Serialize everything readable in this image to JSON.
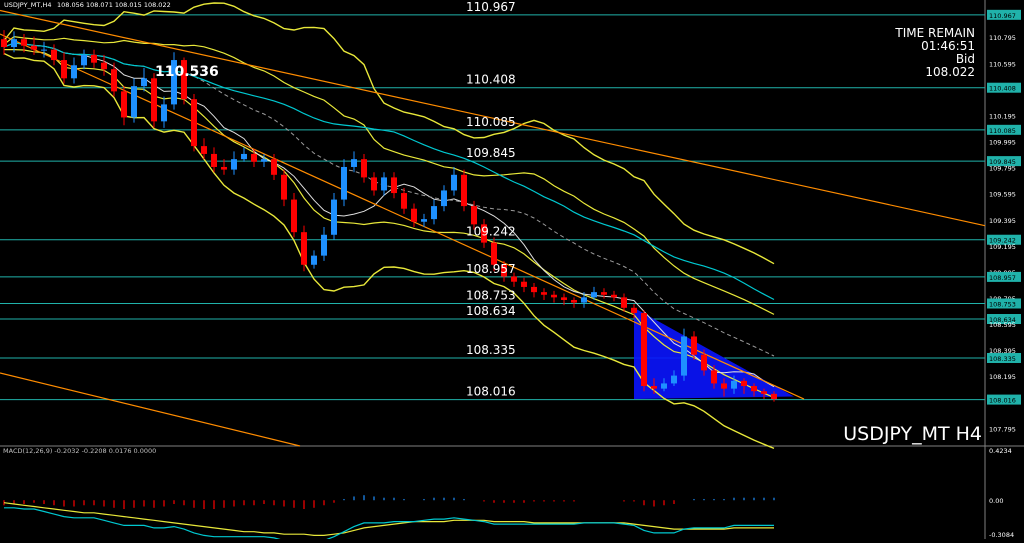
{
  "header": {
    "symbol_line": "USDJPY_MT,H4",
    "ohlc": "108.056 108.071 108.015 108.022"
  },
  "info_panel": {
    "time_remain_label": "TIME REMAIN",
    "time_remain_value": "01:46:51",
    "bid_label": "Bid",
    "bid_value": "108.022"
  },
  "watermark": "USDJPY_MT  H4",
  "macd_header": "MACD(12,26,9) -0.2032 -0.2208 0.0176 0.0000",
  "colors": {
    "background": "#000000",
    "bull": "#1e90ff",
    "bear": "#ff0000",
    "band": "#e8e83a",
    "level_line": "#20b2aa",
    "trend_line": "#ff8c00",
    "ma_cyan": "#00c8d0",
    "triangle_fill": "#0a14ff"
  },
  "chart_data": [
    {
      "type": "candlestick",
      "panel": "price",
      "symbol": "USDJPY_MT",
      "timeframe": "H4",
      "ylim": [
        107.66,
        111.05
      ],
      "yticks": [
        "110.967",
        "110.795",
        "110.595",
        "110.408",
        "110.195",
        "110.085",
        "109.995",
        "109.845",
        "109.795",
        "109.595",
        "109.395",
        "109.242",
        "109.195",
        "108.995",
        "108.957",
        "108.795",
        "108.753",
        "108.634",
        "108.595",
        "108.395",
        "108.335",
        "108.195",
        "108.016",
        "107.795"
      ],
      "highlighted_ticks": [
        "110.967",
        "110.408",
        "110.085",
        "109.845",
        "109.242",
        "108.957",
        "108.753",
        "108.634",
        "108.335",
        "108.016"
      ],
      "level_labels": [
        "110.967",
        "110.408",
        "110.085",
        "109.845",
        "109.242",
        "108.957",
        "108.753",
        "108.634",
        "108.335",
        "108.016"
      ],
      "annotations": [
        {
          "text": "110.536",
          "value": 110.536
        }
      ],
      "close": [
        110.72,
        110.78,
        110.73,
        110.7,
        110.7,
        110.62,
        110.48,
        110.58,
        110.66,
        110.6,
        110.55,
        110.38,
        110.18,
        110.42,
        110.48,
        110.15,
        110.28,
        110.62,
        110.32,
        109.96,
        109.9,
        109.8,
        109.78,
        109.86,
        109.9,
        109.84,
        109.86,
        109.74,
        109.55,
        109.3,
        109.05,
        109.12,
        109.28,
        109.55,
        109.8,
        109.86,
        109.72,
        109.62,
        109.72,
        109.6,
        109.48,
        109.38,
        109.4,
        109.5,
        109.62,
        109.74,
        109.5,
        109.36,
        109.22,
        109.05,
        108.96,
        108.92,
        108.88,
        108.84,
        108.82,
        108.8,
        108.78,
        108.76,
        108.8,
        108.84,
        108.82,
        108.8,
        108.72,
        108.68,
        108.12,
        108.1,
        108.14,
        108.2,
        108.5,
        108.36,
        108.24,
        108.14,
        108.1,
        108.16,
        108.12,
        108.08,
        108.06,
        108.02
      ],
      "open": [
        110.78,
        110.72,
        110.78,
        110.73,
        110.7,
        110.7,
        110.62,
        110.48,
        110.58,
        110.66,
        110.6,
        110.55,
        110.38,
        110.18,
        110.42,
        110.48,
        110.15,
        110.28,
        110.62,
        110.32,
        109.96,
        109.9,
        109.8,
        109.78,
        109.86,
        109.9,
        109.84,
        109.86,
        109.74,
        109.55,
        109.3,
        109.05,
        109.12,
        109.28,
        109.55,
        109.8,
        109.86,
        109.72,
        109.62,
        109.72,
        109.6,
        109.48,
        109.38,
        109.4,
        109.5,
        109.62,
        109.74,
        109.5,
        109.36,
        109.22,
        109.05,
        108.96,
        108.92,
        108.88,
        108.84,
        108.82,
        108.8,
        108.78,
        108.76,
        108.8,
        108.84,
        108.82,
        108.8,
        108.72,
        108.68,
        108.12,
        108.1,
        108.14,
        108.2,
        108.5,
        108.36,
        108.24,
        108.14,
        108.1,
        108.16,
        108.12,
        108.08,
        108.06
      ],
      "high": [
        110.85,
        110.84,
        110.82,
        110.8,
        110.76,
        110.74,
        110.68,
        110.64,
        110.7,
        110.7,
        110.66,
        110.6,
        110.42,
        110.48,
        110.56,
        110.52,
        110.34,
        110.68,
        110.64,
        110.36,
        110.02,
        109.95,
        109.86,
        109.92,
        109.95,
        109.94,
        109.9,
        109.9,
        109.78,
        109.6,
        109.35,
        109.16,
        109.34,
        109.6,
        109.86,
        109.92,
        109.9,
        109.76,
        109.76,
        109.76,
        109.64,
        109.52,
        109.44,
        109.55,
        109.66,
        109.8,
        109.78,
        109.54,
        109.4,
        109.26,
        109.08,
        108.99,
        108.95,
        108.91,
        108.87,
        108.85,
        108.83,
        108.8,
        108.84,
        108.88,
        108.87,
        108.85,
        108.83,
        108.75,
        108.7,
        108.18,
        108.18,
        108.24,
        108.56,
        108.54,
        108.4,
        108.28,
        108.18,
        108.2,
        108.18,
        108.14,
        108.1,
        108.08
      ],
      "low": [
        110.66,
        110.68,
        110.68,
        110.66,
        110.64,
        110.58,
        110.44,
        110.44,
        110.55,
        110.56,
        110.5,
        110.34,
        110.12,
        110.14,
        110.38,
        110.1,
        110.1,
        110.24,
        110.28,
        109.92,
        109.86,
        109.76,
        109.74,
        109.74,
        109.84,
        109.8,
        109.8,
        109.7,
        109.5,
        109.26,
        109.0,
        109.02,
        109.08,
        109.24,
        109.5,
        109.76,
        109.68,
        109.58,
        109.58,
        109.56,
        109.44,
        109.34,
        109.34,
        109.36,
        109.46,
        109.58,
        109.46,
        109.32,
        109.18,
        109.0,
        108.92,
        108.88,
        108.84,
        108.8,
        108.78,
        108.76,
        108.74,
        108.72,
        108.72,
        108.78,
        108.79,
        108.77,
        108.69,
        108.64,
        108.08,
        108.06,
        108.08,
        108.12,
        108.16,
        108.32,
        108.2,
        108.1,
        108.04,
        108.06,
        108.06,
        108.04,
        108.02,
        108.0
      ]
    },
    {
      "type": "bar",
      "panel": "macd",
      "ylim": [
        -0.3084,
        0.4234
      ],
      "yticks": [
        "0.4234",
        "0.00",
        "-0.3084"
      ],
      "histogram": [
        -0.04,
        -0.03,
        -0.03,
        -0.02,
        -0.03,
        -0.04,
        -0.05,
        -0.05,
        -0.04,
        -0.04,
        -0.05,
        -0.06,
        -0.07,
        -0.06,
        -0.05,
        -0.06,
        -0.05,
        -0.03,
        -0.04,
        -0.06,
        -0.07,
        -0.07,
        -0.06,
        -0.05,
        -0.04,
        -0.04,
        -0.03,
        -0.04,
        -0.05,
        -0.06,
        -0.07,
        -0.06,
        -0.04,
        -0.02,
        0.01,
        0.03,
        0.04,
        0.03,
        0.02,
        0.02,
        0.01,
        0.0,
        0.01,
        0.02,
        0.02,
        0.02,
        0.01,
        0.0,
        -0.01,
        -0.02,
        -0.02,
        -0.02,
        -0.02,
        -0.01,
        -0.01,
        -0.01,
        -0.01,
        -0.01,
        0.0,
        0.0,
        0.0,
        0.0,
        -0.01,
        -0.01,
        -0.04,
        -0.05,
        -0.04,
        -0.03,
        0.0,
        0.01,
        0.01,
        0.01,
        0.01,
        0.02,
        0.02,
        0.02,
        0.02,
        0.02
      ],
      "signal": [
        -0.02,
        -0.03,
        -0.04,
        -0.05,
        -0.06,
        -0.07,
        -0.08,
        -0.09,
        -0.1,
        -0.1,
        -0.11,
        -0.12,
        -0.13,
        -0.14,
        -0.15,
        -0.16,
        -0.17,
        -0.18,
        -0.19,
        -0.2,
        -0.21,
        -0.22,
        -0.23,
        -0.24,
        -0.25,
        -0.25,
        -0.26,
        -0.26,
        -0.27,
        -0.27,
        -0.27,
        -0.28,
        -0.28,
        -0.27,
        -0.26,
        -0.24,
        -0.22,
        -0.21,
        -0.2,
        -0.19,
        -0.18,
        -0.17,
        -0.17,
        -0.17,
        -0.17,
        -0.16,
        -0.16,
        -0.16,
        -0.16,
        -0.17,
        -0.17,
        -0.17,
        -0.17,
        -0.18,
        -0.18,
        -0.18,
        -0.18,
        -0.18,
        -0.18,
        -0.18,
        -0.18,
        -0.18,
        -0.18,
        -0.19,
        -0.2,
        -0.21,
        -0.22,
        -0.23,
        -0.23,
        -0.23,
        -0.23,
        -0.23,
        -0.23,
        -0.22,
        -0.22,
        -0.22,
        -0.22,
        -0.22
      ],
      "macd": [
        -0.06,
        -0.06,
        -0.07,
        -0.07,
        -0.09,
        -0.11,
        -0.13,
        -0.14,
        -0.14,
        -0.14,
        -0.16,
        -0.18,
        -0.2,
        -0.2,
        -0.2,
        -0.22,
        -0.22,
        -0.21,
        -0.23,
        -0.26,
        -0.28,
        -0.29,
        -0.29,
        -0.29,
        -0.29,
        -0.29,
        -0.29,
        -0.3,
        -0.32,
        -0.33,
        -0.34,
        -0.34,
        -0.32,
        -0.29,
        -0.25,
        -0.21,
        -0.18,
        -0.18,
        -0.18,
        -0.17,
        -0.17,
        -0.17,
        -0.16,
        -0.15,
        -0.15,
        -0.14,
        -0.15,
        -0.16,
        -0.17,
        -0.19,
        -0.19,
        -0.19,
        -0.19,
        -0.19,
        -0.19,
        -0.19,
        -0.19,
        -0.19,
        -0.18,
        -0.18,
        -0.18,
        -0.18,
        -0.19,
        -0.2,
        -0.24,
        -0.26,
        -0.26,
        -0.26,
        -0.23,
        -0.22,
        -0.22,
        -0.22,
        -0.22,
        -0.2,
        -0.2,
        -0.2,
        -0.2,
        -0.2
      ]
    }
  ]
}
